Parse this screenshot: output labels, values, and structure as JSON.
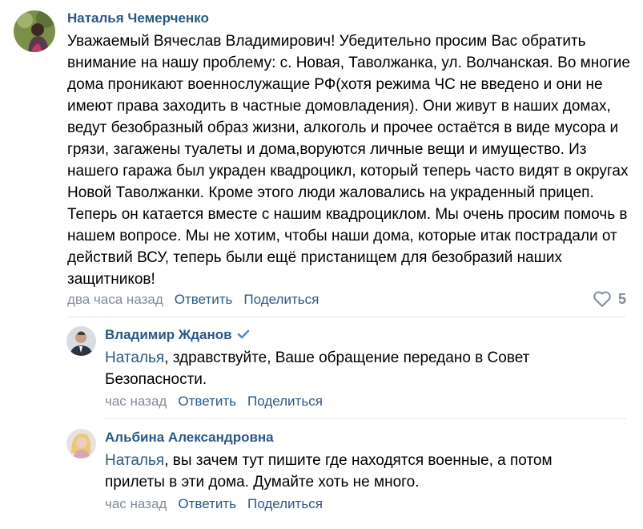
{
  "comments": [
    {
      "author": "Наталья Чемерченко",
      "text": "Уважаемый Вячеслав Владимирович! Убедительно просим Вас обратить внимание на нашу проблему: с. Новая, Таволжанка, ул. Волчанская. Во многие дома проникают военнослужащие РФ(хотя режима ЧС не введено и они не имеют права заходить в частные домовладения). Они живут в наших домах, ведут безобразный образ жизни, алкоголь и прочее остаётся в виде мусора и грязи, загажены туалеты и дома,воруются личные вещи и имущество. Из нашего гаража был украден квадроцикл, который теперь часто видят в округах Новой Таволжанки. Кроме этого люди жаловались на украденный прицеп. Теперь он катается вместе с нашим квадроциклом. Мы очень просим помочь в нашем вопросе. Мы не хотим, чтобы наши дома, которые итак пострадали от действий ВСУ, теперь были ещё пристанищем для безобразий наших защитников!",
      "time": "два часа назад",
      "reply_label": "Ответить",
      "share_label": "Поделиться",
      "likes": "5"
    }
  ],
  "replies": [
    {
      "author": "Владимир Жданов",
      "mention": "Наталья",
      "text": ", здравствуйте, Ваше обращение передано в Совет Безопасности.",
      "time": "час назад",
      "reply_label": "Ответить",
      "share_label": "Поделиться"
    },
    {
      "author": "Альбина Александровна",
      "mention": "Наталья",
      "text": ", вы зачем тут пишите где находятся военные, а потом прилеты в эти дома. Думайте хоть не много.",
      "time": "час назад",
      "reply_label": "Ответить",
      "share_label": "Поделиться"
    }
  ],
  "colors": {
    "link": "#2a5885",
    "meta": "#818c99",
    "verified": "#4986cc"
  }
}
